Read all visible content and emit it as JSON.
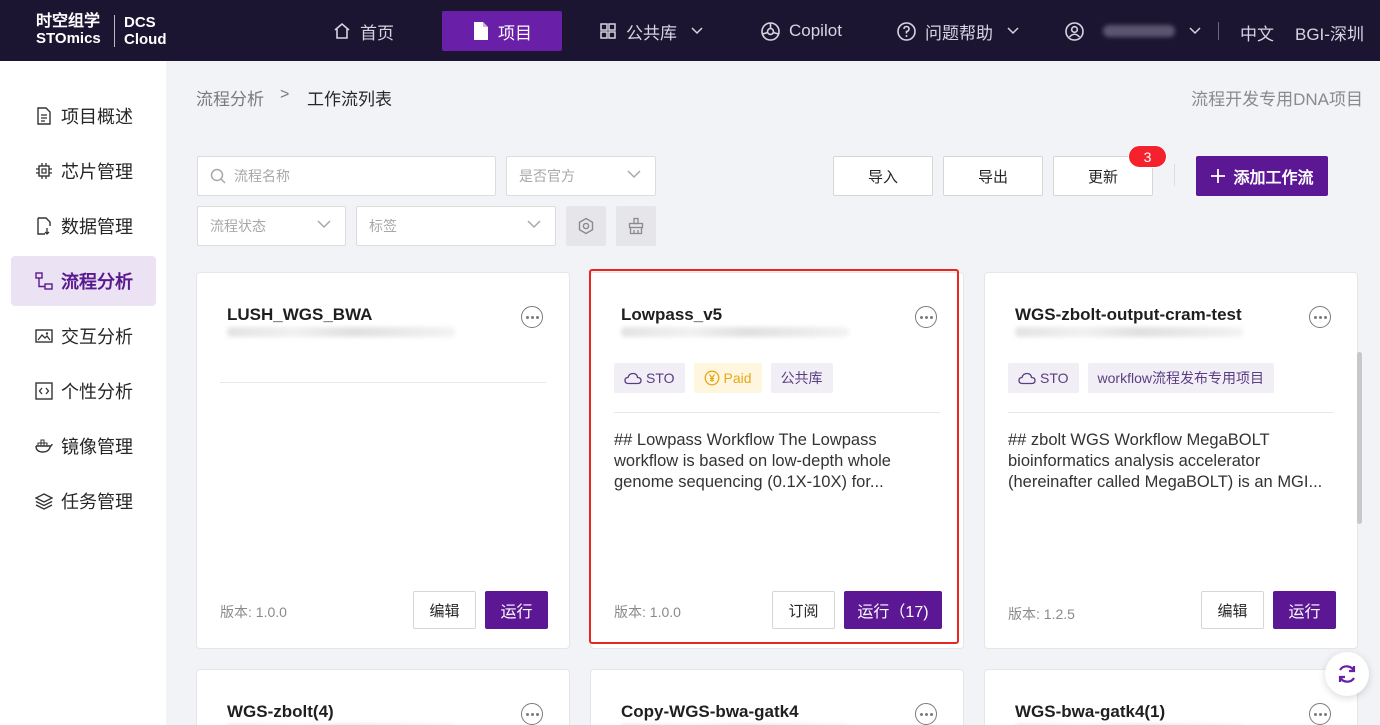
{
  "logo": {
    "zh": "时空组学",
    "en": "STOmics",
    "brand_line1": "DCS",
    "brand_line2": "Cloud"
  },
  "topnav": [
    {
      "label": "首页",
      "icon": "home-icon"
    },
    {
      "label": "项目",
      "icon": "file-icon",
      "active": true
    },
    {
      "label": "公共库",
      "icon": "grid-icon"
    },
    {
      "label": "Copilot",
      "icon": "copilot-icon"
    },
    {
      "label": "问题帮助",
      "icon": "help-icon"
    }
  ],
  "user": {
    "name_hidden": true
  },
  "language": "中文",
  "region": "BGI-深圳",
  "sidebar": {
    "items": [
      {
        "label": "项目概述",
        "icon": "document-icon"
      },
      {
        "label": "芯片管理",
        "icon": "chip-icon"
      },
      {
        "label": "数据管理",
        "icon": "data-file-icon"
      },
      {
        "label": "流程分析",
        "icon": "flow-icon",
        "active": true
      },
      {
        "label": "交互分析",
        "icon": "image-icon"
      },
      {
        "label": "个性分析",
        "icon": "code-icon"
      },
      {
        "label": "镜像管理",
        "icon": "docker-icon"
      },
      {
        "label": "任务管理",
        "icon": "layers-icon"
      }
    ]
  },
  "breadcrumb": {
    "parent": "流程分析",
    "separator": ">",
    "current": "工作流列表"
  },
  "project_name": "流程开发专用DNA项目",
  "filters": {
    "search_placeholder": "流程名称",
    "official_placeholder": "是否官方",
    "status_placeholder": "流程状态",
    "tag_placeholder": "标签"
  },
  "actions": {
    "import_label": "导入",
    "export_label": "导出",
    "update_label": "更新",
    "update_badge": "3",
    "add_label": "添加工作流"
  },
  "cards": [
    {
      "title": "LUSH_WGS_BWA",
      "tags": [],
      "description": "",
      "version_label": "版本:",
      "version": "1.0.0",
      "buttons": [
        "编辑",
        "运行"
      ]
    },
    {
      "title": "Lowpass_v5",
      "tags": [
        "STO",
        "Paid",
        "公共库"
      ],
      "description": "## Lowpass Workflow The Lowpass workflow is based on low-depth whole genome sequencing (0.1X-10X) for...",
      "version_label": "版本:",
      "version": "1.0.0",
      "buttons": [
        "订阅",
        "运行（17)"
      ],
      "highlighted": true
    },
    {
      "title": "WGS-zbolt-output-cram-test",
      "tags": [
        "STO",
        "workflow流程发布专用项目"
      ],
      "description": "## zbolt WGS Workflow MegaBOLT bioinformatics analysis accelerator (hereinafter called MegaBOLT) is an MGI...",
      "version_label": "版本:",
      "version": "1.2.5",
      "buttons": [
        "编辑",
        "运行"
      ]
    },
    {
      "title": "WGS-zbolt(4)"
    },
    {
      "title": "Copy-WGS-bwa-gatk4"
    },
    {
      "title": "WGS-bwa-gatk4(1)"
    }
  ],
  "colors": {
    "topbar": "#1c1532",
    "primary": "#5c1894",
    "highlight_border": "#e8281f",
    "badge": "#f5222d"
  }
}
